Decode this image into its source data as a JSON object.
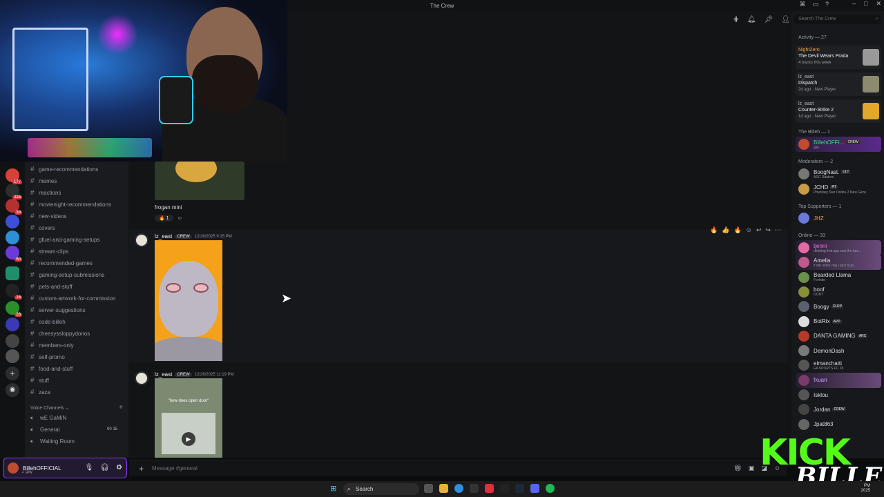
{
  "window": {
    "title": "The Crew"
  },
  "channels": [
    "game-recommendations",
    "memes",
    "reactions",
    "movienight-recommendations",
    "new-videos",
    "covers",
    "gfuel-and-gaming-setups",
    "stream-clips",
    "recommended-games",
    "gaming-setup-submissions",
    "pets-and-stuff",
    "custom-artwork-for-commission",
    "server-suggestions",
    "code-billeh",
    "cheesyssloppydonos",
    "members-only",
    "self-promo",
    "food-and-stuff",
    "stuff",
    "zaza"
  ],
  "voice": {
    "header": "Voice Channels",
    "channels": [
      {
        "name": "wE GaMiN",
        "badge": ""
      },
      {
        "name": "General",
        "badge": "00 15"
      },
      {
        "name": "Waiting Room",
        "badge": ""
      }
    ]
  },
  "server_badges": [
    "177",
    "116",
    "39",
    "60",
    "16",
    "26"
  ],
  "user": {
    "name": "BillehOFFICIAL",
    "status": "gay"
  },
  "messages": {
    "prev_caption": "frogan mini",
    "prev_reaction_count": "1",
    "m1": {
      "author": "lz_east",
      "tag": "CREW",
      "time": "12/26/2025 9:15 PM"
    },
    "m2": {
      "author": "lz_east",
      "tag": "CREW",
      "time": "12/26/2025 11:19 PM",
      "video_caption": "\"how does open door\""
    }
  },
  "composer": {
    "placeholder": "Message #general"
  },
  "members_panel": {
    "search_placeholder": "Search The Crew",
    "activity_header": "Activity — 27",
    "activities": [
      {
        "user": "NightZero",
        "game": "The Devil Wears Prada",
        "meta": "4 tracks this week"
      },
      {
        "user": "lz_east",
        "game": "Dispatch",
        "meta": "2d ago · New Player"
      },
      {
        "user": "lz_east",
        "game": "Counter-Strike 2",
        "meta": "1d ago · New Player"
      }
    ],
    "billeh_header": "The Billeh — 1",
    "billeh_member": {
      "name": "BillehOFFI...",
      "badge": "CREW",
      "status": "gay"
    },
    "mods_header": "Moderators — 2",
    "mods": [
      {
        "name": "BoogNast.",
        "badge": "ULT",
        "status": "ARC Raiders"
      },
      {
        "name": "JCHD",
        "badge": "RT",
        "status": "Phantasy Star Online 2 New Gens"
      }
    ],
    "supporters_header": "Top Supporters — 1",
    "supporters": [
      {
        "name": "JHZ"
      }
    ],
    "online_header": "Online — 33",
    "online": [
      {
        "name": "tjenni",
        "badge": "",
        "status": "deleting that app was the bes..."
      },
      {
        "name": "Amelia",
        "badge": "",
        "status": "if dat onion ring i pick it up..."
      },
      {
        "name": "Bearded Llama",
        "badge": "",
        "status": "Fortnite"
      },
      {
        "name": "boof",
        "badge": "",
        "status": "DONT"
      },
      {
        "name": "Boogy",
        "badge": "CLRP",
        "status": ""
      },
      {
        "name": "BotRix",
        "badge": "APP",
        "status": ""
      },
      {
        "name": "DANTA GAMING",
        "badge": "ARC",
        "status": ""
      },
      {
        "name": "DemonDash",
        "badge": "",
        "status": ""
      },
      {
        "name": "eimanchatti",
        "badge": "",
        "status": "EA SPORTS FC 26"
      },
      {
        "name": "fxuan",
        "badge": "",
        "status": ""
      },
      {
        "name": "Isklou",
        "badge": "",
        "status": ""
      },
      {
        "name": "Jordan",
        "badge": "CREW",
        "status": ""
      },
      {
        "name": "Jpat863",
        "badge": "",
        "status": ""
      }
    ]
  },
  "overlay": {
    "brand": "KICK",
    "streamer": "BILLEH"
  },
  "taskbar": {
    "search": "Search",
    "time": "PM",
    "date": "2025"
  },
  "colors": {
    "accent": "#5865f2",
    "kick": "#53fc18",
    "nitro": "#8b3cf4"
  }
}
